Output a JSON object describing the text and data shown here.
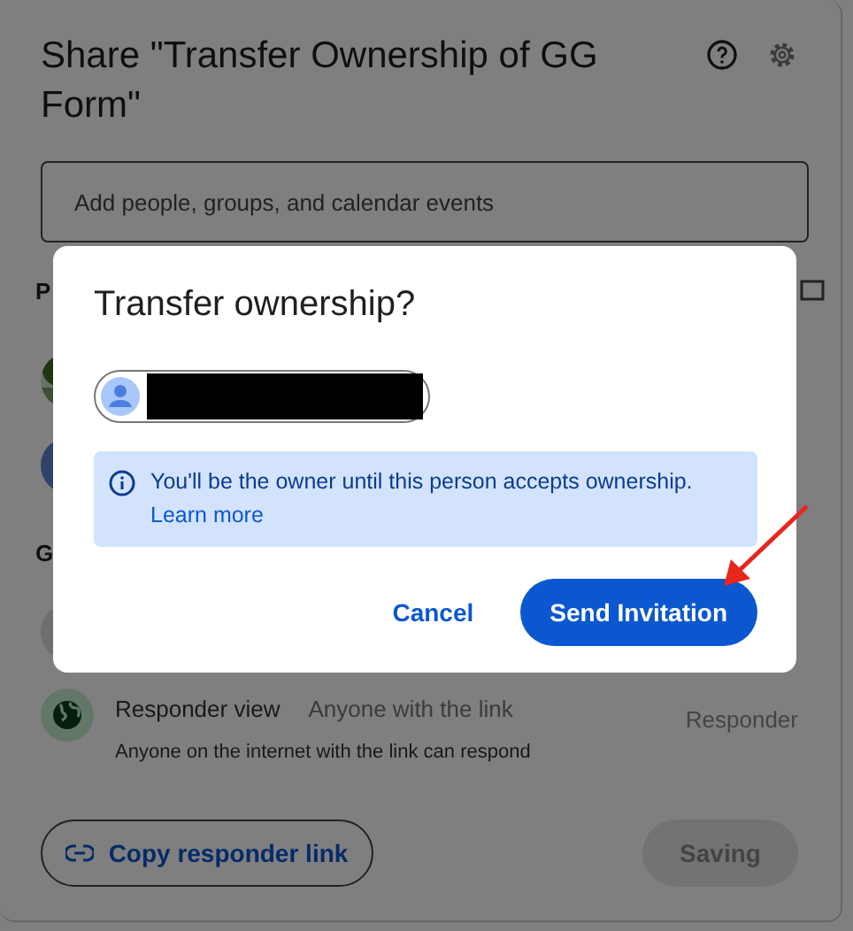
{
  "share_dialog": {
    "title": "Share \"Transfer Ownership of GG Form\"",
    "add_field": {
      "placeholder": "Add people, groups, and calendar events"
    },
    "people_heading": "P",
    "general_heading": "G",
    "general_access": {
      "label": "Responder view",
      "scope": "Anyone with the link",
      "description": "Anyone on the internet with the link can respond",
      "role": "Responder"
    },
    "copy_link_button": "Copy responder link",
    "save_button": {
      "label": "Saving",
      "disabled": true
    }
  },
  "transfer_dialog": {
    "title": "Transfer ownership?",
    "info": "You'll be the owner until this person accepts ownership.",
    "learn_more": "Learn more",
    "buttons": [
      {
        "label": "Cancel",
        "kind": "text"
      },
      {
        "label": "Send Invitation",
        "kind": "filled"
      }
    ]
  }
}
